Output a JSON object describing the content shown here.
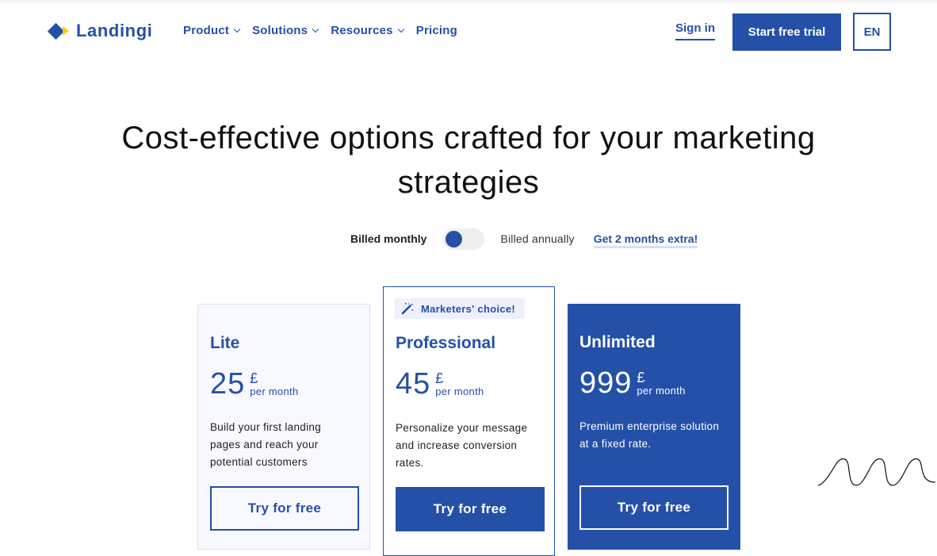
{
  "header": {
    "logo_text": "Landingi",
    "nav": [
      {
        "label": "Product",
        "has_dropdown": true
      },
      {
        "label": "Solutions",
        "has_dropdown": true
      },
      {
        "label": "Resources",
        "has_dropdown": true
      },
      {
        "label": "Pricing",
        "has_dropdown": false
      }
    ],
    "sign_in": "Sign in",
    "start_trial": "Start free trial",
    "language": "EN"
  },
  "hero": {
    "title": "Cost-effective options crafted for your marketing strategies"
  },
  "billing": {
    "monthly_label": "Billed monthly",
    "annually_label": "Billed annually",
    "selected": "monthly",
    "promo_link": "Get 2 months extra!"
  },
  "plans": [
    {
      "name": "Lite",
      "price": "25",
      "currency": "£",
      "period": "per month",
      "description": "Build your first landing pages and reach your potential customers",
      "cta": "Try for free"
    },
    {
      "badge": "Marketers' choice!",
      "badge_icon": "magic-wand-icon",
      "name": "Professional",
      "price": "45",
      "currency": "£",
      "period": "per month",
      "description": "Personalize your message and increase conversion rates.",
      "cta": "Try for free"
    },
    {
      "name": "Unlimited",
      "price": "999",
      "currency": "£",
      "period": "per month",
      "description": "Premium enterprise solution at a fixed rate.",
      "cta": "Try for free"
    }
  ],
  "colors": {
    "brand_blue": "#2450a8",
    "brand_yellow": "#ffcc0d",
    "lite_card_bg": "#f8f9ff",
    "badge_bg": "#eef0fd"
  }
}
